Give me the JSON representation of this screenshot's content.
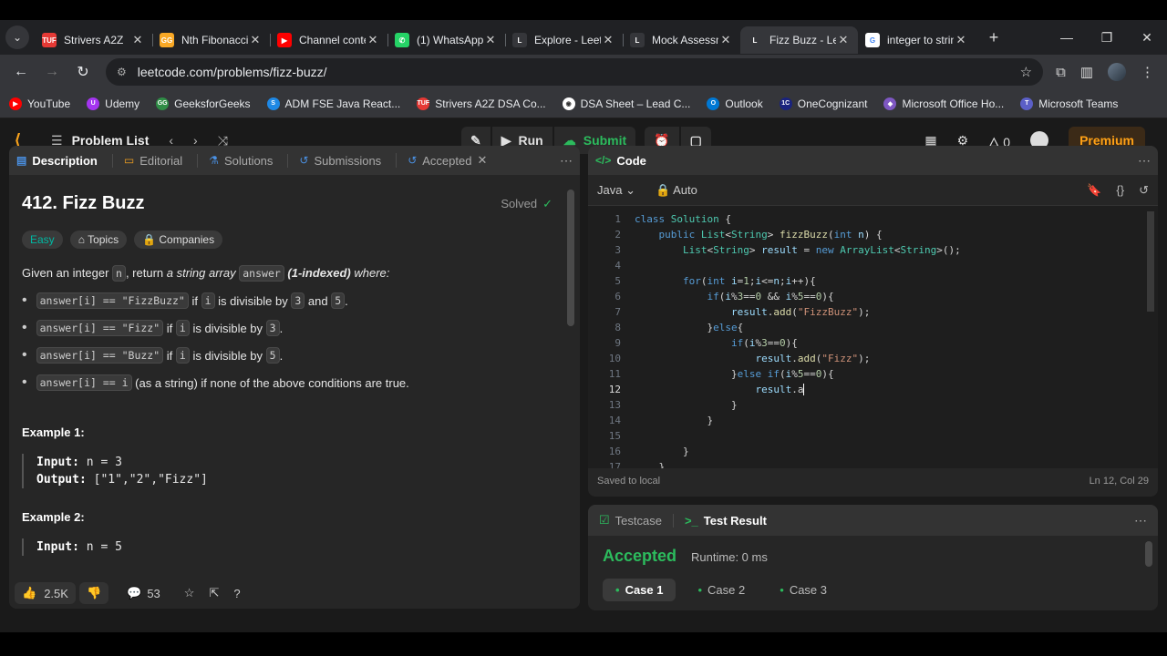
{
  "browser": {
    "tabs": [
      {
        "title": "Strivers A2Z",
        "fav_color": "#e53935",
        "fav_text": "TUF"
      },
      {
        "title": "Nth Fibonacci",
        "fav_color": "#f9a825",
        "fav_text": "GG"
      },
      {
        "title": "Channel content",
        "fav_color": "#ff0000",
        "fav_text": "▶"
      },
      {
        "title": "(1) WhatsApp",
        "fav_color": "#25d366",
        "fav_text": "✆"
      },
      {
        "title": "Explore - LeetCode",
        "fav_color": "#35363a",
        "fav_text": "L"
      },
      {
        "title": "Mock Assessment",
        "fav_color": "#35363a",
        "fav_text": "L"
      },
      {
        "title": "Fizz Buzz - LeetCode",
        "fav_color": "#35363a",
        "fav_text": "L",
        "active": true
      },
      {
        "title": "integer to string",
        "fav_color": "#ffffff",
        "fav_text": "G"
      }
    ],
    "url": "leetcode.com/problems/fizz-buzz/",
    "bookmarks": [
      {
        "label": "YouTube",
        "color": "#ff0000",
        "glyph": "▶"
      },
      {
        "label": "Udemy",
        "color": "#a435f0",
        "glyph": "U"
      },
      {
        "label": "GeeksforGeeks",
        "color": "#2f8d46",
        "glyph": "GG"
      },
      {
        "label": "ADM FSE Java React...",
        "color": "#1e88e5",
        "glyph": "S"
      },
      {
        "label": "Strivers A2Z DSA Co...",
        "color": "#e53935",
        "glyph": "TUF"
      },
      {
        "label": "DSA Sheet – Lead C...",
        "color": "#ffffff",
        "glyph": "◉"
      },
      {
        "label": "Outlook",
        "color": "#0078d4",
        "glyph": "O"
      },
      {
        "label": "OneCognizant",
        "color": "#1a237e",
        "glyph": "1C"
      },
      {
        "label": "Microsoft Office Ho...",
        "color": "#7e57c2",
        "glyph": "◆"
      },
      {
        "label": "Microsoft Teams",
        "color": "#5b5fc7",
        "glyph": "T"
      }
    ]
  },
  "lc": {
    "problem_list": "Problem List",
    "run": "Run",
    "submit": "Submit",
    "streak": "0",
    "premium": "Premium"
  },
  "left": {
    "tabs": [
      "Description",
      "Editorial",
      "Solutions",
      "Submissions",
      "Accepted"
    ],
    "title": "412. Fizz Buzz",
    "solved": "Solved",
    "difficulty": "Easy",
    "topics": "Topics",
    "companies": "Companies",
    "stmt_prefix": "Given an integer ",
    "stmt_n": "n",
    "stmt_mid": ", return ",
    "stmt_em": "a string array",
    "stmt_answer": "answer",
    "stmt_b": "(1-indexed)",
    "stmt_end": " where:",
    "bullets": [
      {
        "code": "answer[i] == \"FizzBuzz\"",
        "t1": " if ",
        "c1": "i",
        "t2": " is divisible by ",
        "c2": "3",
        "t3": " and ",
        "c3": "5",
        "t4": "."
      },
      {
        "code": "answer[i] == \"Fizz\"",
        "t1": " if ",
        "c1": "i",
        "t2": " is divisible by ",
        "c2": "3",
        "t3": ".",
        "c3": "",
        "t4": ""
      },
      {
        "code": "answer[i] == \"Buzz\"",
        "t1": " if ",
        "c1": "i",
        "t2": " is divisible by ",
        "c2": "5",
        "t3": ".",
        "c3": "",
        "t4": ""
      },
      {
        "code": "answer[i] == i",
        "t1": " (as a string) if none of the above conditions are true.",
        "c1": "",
        "t2": "",
        "c2": "",
        "t3": "",
        "c3": "",
        "t4": ""
      }
    ],
    "example1_h": "Example 1:",
    "example1_in_label": "Input:",
    "example1_in": " n = 3",
    "example1_out_label": "Output:",
    "example1_out": " [\"1\",\"2\",\"Fizz\"]",
    "example2_h": "Example 2:",
    "example2_in_label": "Input:",
    "example2_in": " n = 5",
    "likes": "2.5K",
    "comments": "53"
  },
  "code": {
    "header": "Code",
    "language": "Java",
    "mode": "Auto",
    "saved": "Saved to local",
    "position": "Ln 12, Col 29",
    "current_line": 12
  },
  "result": {
    "testcase": "Testcase",
    "test_result": "Test Result",
    "status": "Accepted",
    "runtime": "Runtime: 0 ms",
    "cases": [
      "Case 1",
      "Case 2",
      "Case 3"
    ]
  }
}
